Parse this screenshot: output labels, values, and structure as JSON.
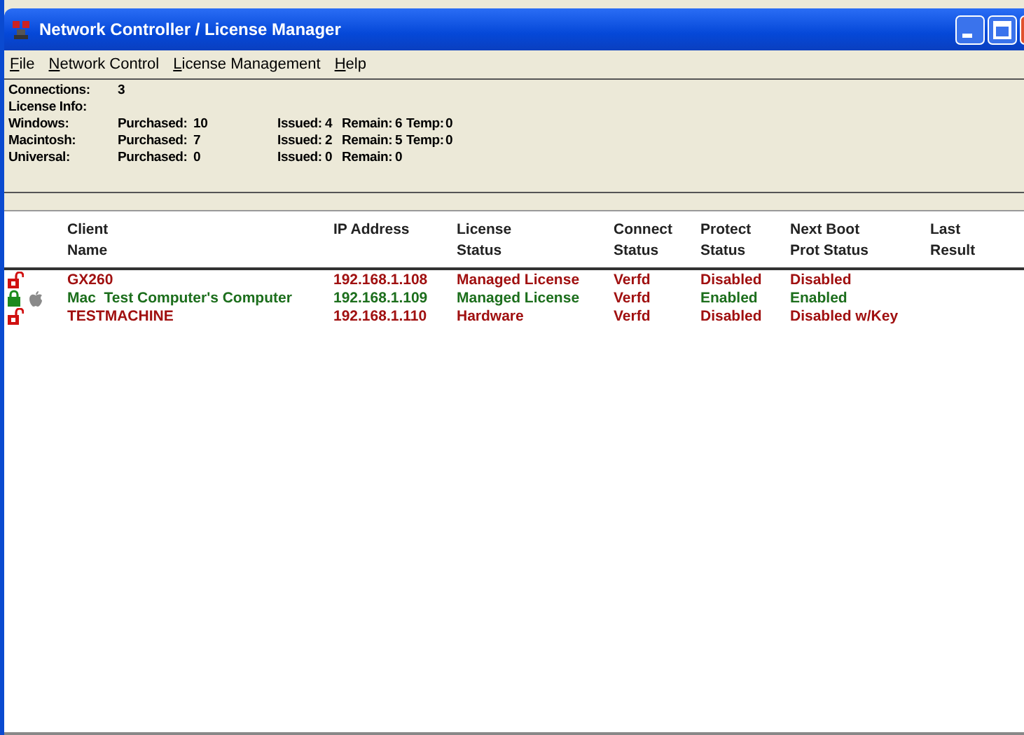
{
  "window": {
    "title": "Network Controller / License Manager"
  },
  "menu": [
    "File",
    "Network Control",
    "License Management",
    "Help"
  ],
  "info": {
    "connections_label": "Connections:",
    "connections": "3",
    "license_label": "License Info:",
    "rows": [
      {
        "name": "Windows:",
        "fields": [
          {
            "label": "Purchased:",
            "value": "10"
          },
          {
            "label": "Issued:",
            "value": "4"
          },
          {
            "label": "Remain:",
            "value": "6"
          },
          {
            "label": "Temp:",
            "value": "0"
          }
        ]
      },
      {
        "name": "Macintosh:",
        "fields": [
          {
            "label": "Purchased:",
            "value": "7"
          },
          {
            "label": "Issued:",
            "value": "2"
          },
          {
            "label": "Remain:",
            "value": "5"
          },
          {
            "label": "Temp:",
            "value": "0"
          }
        ]
      },
      {
        "name": "Universal:",
        "fields": [
          {
            "label": "Purchased:",
            "value": "0"
          },
          {
            "label": "Issued:",
            "value": "0"
          },
          {
            "label": "Remain:",
            "value": "0"
          }
        ]
      }
    ]
  },
  "table": {
    "columns": [
      "Client\nName",
      "IP Address",
      "License\nStatus",
      "Connect\nStatus",
      "Protect\nStatus",
      "Next Boot\nProt Status",
      "Last\nResult"
    ],
    "rows": [
      {
        "locked": false,
        "kind": "pc",
        "cells": [
          "GX260",
          "192.168.1.108",
          "Managed License",
          "Verfd",
          "Disabled",
          "Disabled"
        ]
      },
      {
        "locked": true,
        "kind": "mac",
        "cells": [
          "Mac  Test Computer's Computer",
          "192.168.1.109",
          "Managed License",
          "Verfd",
          "Enabled",
          "Enabled"
        ]
      },
      {
        "locked": false,
        "kind": "pc",
        "cells": [
          "TESTMACHINE",
          "192.168.1.110",
          "Hardware",
          "Verfd",
          "Disabled",
          "Disabled w/Key"
        ]
      }
    ]
  }
}
